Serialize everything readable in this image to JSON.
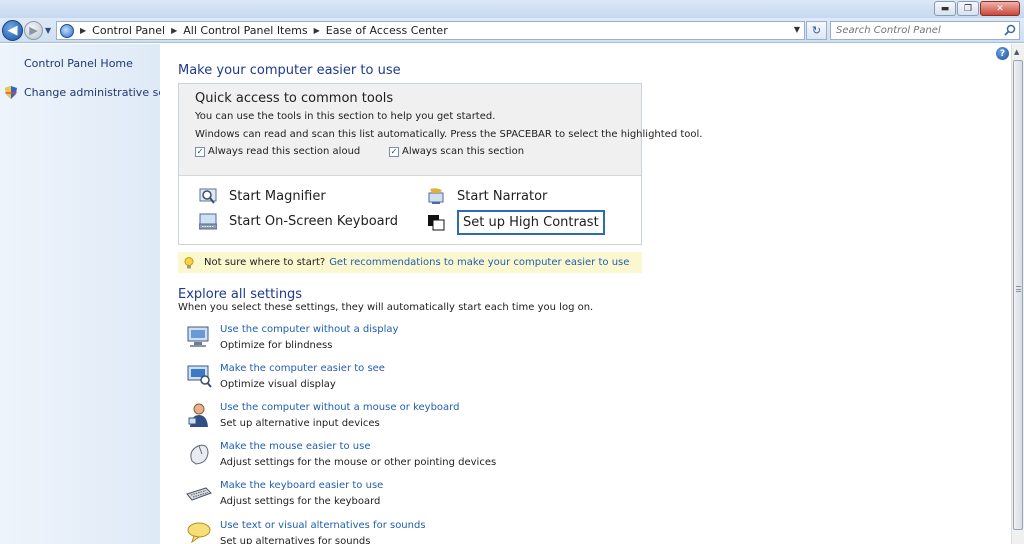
{
  "window": {
    "minimize_glyph": "▬",
    "maximize_glyph": "❐",
    "close_glyph": "✕"
  },
  "nav": {
    "back_glyph": "◀",
    "forward_glyph": "▶",
    "breadcrumbs": [
      "Control Panel",
      "All Control Panel Items",
      "Ease of Access Center"
    ],
    "refresh_glyph": "↻",
    "search_placeholder": "Search Control Panel"
  },
  "left_pane": {
    "home_link": "Control Panel Home",
    "admin_link": "Change administrative settings"
  },
  "main": {
    "help_glyph": "?",
    "title": "Make your computer easier to use",
    "quick_access": {
      "title": "Quick access to common tools",
      "line1": "You can use the tools in this section to help you get started.",
      "line2": "Windows can read and scan this list automatically.  Press the SPACEBAR to select the highlighted tool.",
      "checkbox_read": "Always read this section aloud",
      "checkbox_scan": "Always scan this section",
      "tools": {
        "magnifier": "Start Magnifier",
        "narrator": "Start Narrator",
        "keyboard": "Start On-Screen Keyboard",
        "contrast": "Set up High Contrast"
      }
    },
    "tip": {
      "question": "Not sure where to start?",
      "link": "Get recommendations to make your computer easier to use"
    },
    "explore": {
      "title": "Explore all settings",
      "subtitle": "When you select these settings, they will automatically start each time you log on.",
      "items": [
        {
          "link": "Use the computer without a display",
          "desc": "Optimize for blindness"
        },
        {
          "link": "Make the computer easier to see",
          "desc": "Optimize visual display"
        },
        {
          "link": "Use the computer without a mouse or keyboard",
          "desc": "Set up alternative input devices"
        },
        {
          "link": "Make the mouse easier to use",
          "desc": "Adjust settings for the mouse or other pointing devices"
        },
        {
          "link": "Make the keyboard easier to use",
          "desc": "Adjust settings for the keyboard"
        },
        {
          "link": "Use text or visual alternatives for sounds",
          "desc": "Set up alternatives for sounds"
        }
      ]
    }
  }
}
